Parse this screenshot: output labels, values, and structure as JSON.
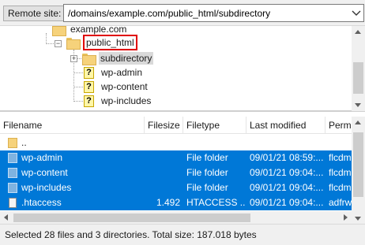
{
  "remote_site": {
    "label": "Remote site:",
    "path": "/domains/example.com/public_html/subdirectory"
  },
  "tree": {
    "nodes": [
      {
        "label": "example.com",
        "icon": "folder-icon"
      },
      {
        "label": "public_html",
        "icon": "folder-icon",
        "highlighted": true,
        "expander": "−"
      },
      {
        "label": "subdirectory",
        "icon": "folder-icon",
        "selected": true,
        "expander": "+"
      },
      {
        "label": "wp-admin",
        "icon": "unknown-icon",
        "glyph": "?"
      },
      {
        "label": "wp-content",
        "icon": "unknown-icon",
        "glyph": "?"
      },
      {
        "label": "wp-includes",
        "icon": "unknown-icon",
        "glyph": "?"
      }
    ]
  },
  "file_list": {
    "columns": [
      "Filename",
      "Filesize",
      "Filetype",
      "Last modified",
      "Perm"
    ],
    "rows": [
      {
        "name": "..",
        "size": "",
        "type": "",
        "modified": "",
        "perms": "",
        "selected": false,
        "icon": "parent-folder-icon"
      },
      {
        "name": "wp-admin",
        "size": "",
        "type": "File folder",
        "modified": "09/01/21 08:59:...",
        "perms": "flcdm",
        "selected": true,
        "icon": "folder-icon"
      },
      {
        "name": "wp-content",
        "size": "",
        "type": "File folder",
        "modified": "09/01/21 09:04:...",
        "perms": "flcdm",
        "selected": true,
        "icon": "folder-icon"
      },
      {
        "name": "wp-includes",
        "size": "",
        "type": "File folder",
        "modified": "09/01/21 09:04:...",
        "perms": "flcdm",
        "selected": true,
        "icon": "folder-icon"
      },
      {
        "name": ".htaccess",
        "size": "1.492",
        "type": "HTACCESS ...",
        "modified": "09/01/21 09:04:...",
        "perms": "adfrw",
        "selected": true,
        "icon": "file-icon"
      }
    ]
  },
  "status": {
    "text": "Selected 28 files and 3 directories. Total size: 187.018 bytes"
  },
  "colors": {
    "selection": "#0078d7",
    "highlight_box": "#e00000"
  }
}
